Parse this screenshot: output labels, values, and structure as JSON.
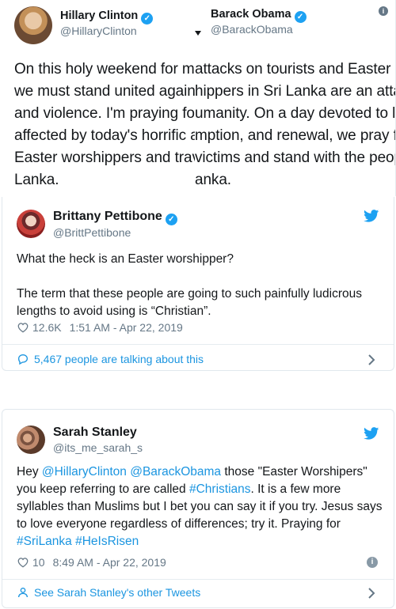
{
  "top_left": {
    "name": "Hillary Clinton",
    "handle": "@HillaryClinton",
    "lines": [
      "On this holy weekend for ma",
      "we must stand united agains",
      "and violence. I'm praying for",
      "affected by today's horrific a",
      "Easter worshippers and trav",
      "Lanka."
    ]
  },
  "top_right": {
    "name": "Barack Obama",
    "handle": "@BarackObama",
    "lines": [
      "attacks on tourists and Easter",
      "hippers in Sri Lanka are an atta",
      "umanity. On a day devoted to lo",
      "mption, and renewal, we pray f",
      "victims and stand with the peop",
      "anka."
    ]
  },
  "tweet1": {
    "name": "Brittany Pettibone",
    "handle": "@BrittPettibone",
    "para1": "What the heck is an Easter worshipper?",
    "para2": "The term that these people are going to such painfully ludicrous lengths to avoid using is “Christian”.",
    "likes": "12.6K",
    "timestamp": "1:51 AM - Apr 22, 2019",
    "talking": "5,467 people are talking about this"
  },
  "tweet2": {
    "name": "Sarah Stanley",
    "handle": "@its_me_sarah_s",
    "t1": "Hey ",
    "m1": "@HillaryClinton",
    "t2": " ",
    "m2": "@BarackObama",
    "t3": " those \"Easter Worshipers\" you keep referring to are called ",
    "h1": "#Christians",
    "t4": ". It is a few more syllables than Muslims but I bet you can say it if you try. Jesus says to love everyone regardless of differences; try it. Praying for ",
    "h2": "#SriLanka",
    "t5": " ",
    "h3": "#HeIsRisen",
    "likes": "10",
    "timestamp": "8:49 AM - Apr 22, 2019",
    "more_tweets": "See Sarah Stanley's other Tweets"
  },
  "colors": {
    "link": "#1b95e0",
    "verified": "#1da1f2",
    "muted": "#657786",
    "border": "#e1e8ed"
  },
  "icons": [
    "verified-badge-icon",
    "twitter-bird-icon",
    "heart-icon",
    "comment-icon",
    "person-icon",
    "chevron-right-icon",
    "info-icon"
  ]
}
